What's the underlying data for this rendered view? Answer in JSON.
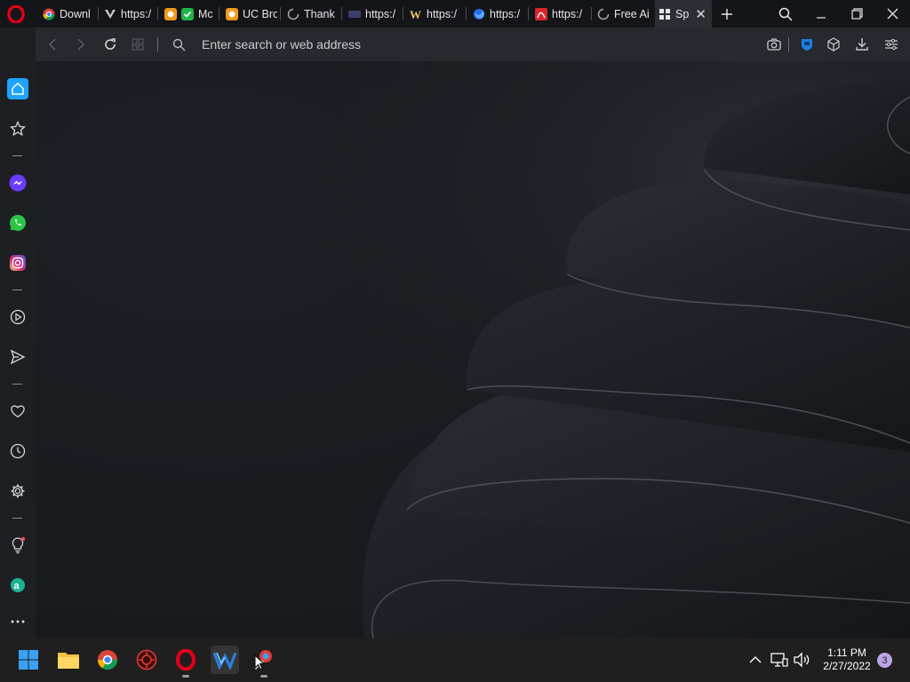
{
  "browser": {
    "tabs": [
      {
        "title": "Downl",
        "icon": "chrome-icon"
      },
      {
        "title": "https:/",
        "icon": "vivaldi-icon"
      },
      {
        "title": "Mc",
        "icon": "uc-icon"
      },
      {
        "title": "UC Bro",
        "icon": "uc-icon"
      },
      {
        "title": "Thank",
        "icon": "loading-icon"
      },
      {
        "title": "https:/",
        "icon": "site-icon"
      },
      {
        "title": "https:/",
        "icon": "w-icon"
      },
      {
        "title": "https:/",
        "icon": "firefox-icon"
      },
      {
        "title": "https:/",
        "icon": "adobe-icon"
      },
      {
        "title": "Free Ai",
        "icon": "loading-icon"
      },
      {
        "title": "Sp",
        "icon": "speed-dial-icon",
        "active": true
      }
    ],
    "address": {
      "placeholder": "Enter search or web address"
    }
  },
  "taskbar": {
    "time": "1:11 PM",
    "date": "2/27/2022",
    "notification_count": "3"
  },
  "colors": {
    "accent": "#1fa3ff",
    "opera_red": "#e0001b",
    "messenger": "#6a3cff",
    "whatsapp": "#2ac545",
    "instagram": "#e1306c"
  }
}
